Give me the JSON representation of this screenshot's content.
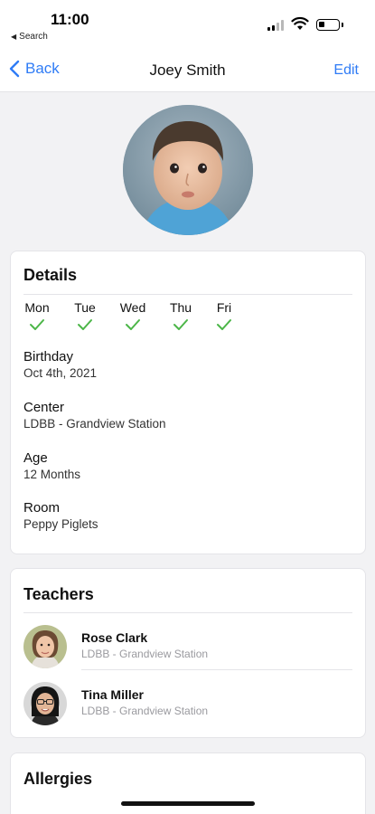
{
  "status_bar": {
    "time": "11:00",
    "back_app_label": "Search"
  },
  "nav": {
    "back_label": "Back",
    "title": "Joey Smith",
    "edit_label": "Edit"
  },
  "details": {
    "title": "Details",
    "days": [
      {
        "label": "Mon",
        "checked": true
      },
      {
        "label": "Tue",
        "checked": true
      },
      {
        "label": "Wed",
        "checked": true
      },
      {
        "label": "Thu",
        "checked": true
      },
      {
        "label": "Fri",
        "checked": true
      }
    ],
    "fields": [
      {
        "label": "Birthday",
        "value": "Oct 4th, 2021"
      },
      {
        "label": "Center",
        "value": "LDBB - Grandview Station"
      },
      {
        "label": "Age",
        "value": "12 Months"
      },
      {
        "label": "Room",
        "value": "Peppy Piglets"
      }
    ]
  },
  "teachers": {
    "title": "Teachers",
    "list": [
      {
        "name": "Rose Clark",
        "center": "LDBB - Grandview Station"
      },
      {
        "name": "Tina Miller",
        "center": "LDBB - Grandview Station"
      }
    ]
  },
  "allergies": {
    "title": "Allergies"
  },
  "colors": {
    "accent": "#2f7cf6",
    "check": "#4cb648",
    "background": "#f2f2f4"
  }
}
